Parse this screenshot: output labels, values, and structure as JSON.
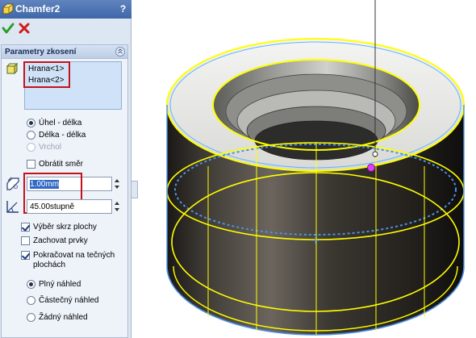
{
  "window": {
    "title": "Chamfer2",
    "help": "?"
  },
  "group": {
    "title": "Parametry zkosení"
  },
  "edges": {
    "items": [
      "Hrana<1>",
      "Hrana<2>"
    ]
  },
  "chamfer_type": {
    "options": [
      "Úhel - délka",
      "Délka - délka",
      "Vrchol"
    ],
    "selected": "Úhel - délka",
    "disabled": [
      "Vrchol"
    ]
  },
  "flip": {
    "label": "Obrátit směr",
    "checked": false
  },
  "distance": {
    "value": "1.00mm"
  },
  "angle": {
    "value": "45.00stupně"
  },
  "options": {
    "select_through_faces": {
      "label": "Výběr skrz plochy",
      "checked": true
    },
    "keep_features": {
      "label": "Zachovat prvky",
      "checked": false
    },
    "tangent_propagation": {
      "label": "Pokračovat na tečných plochách",
      "line1": "Pokračovat na tečných",
      "line2": "plochách",
      "checked": true
    }
  },
  "preview": {
    "options": [
      "Plný náhled",
      "Částečný náhled",
      "Žádný náhled"
    ],
    "selected": "Plný náhled"
  },
  "colors": {
    "title_bar": "#3f66a8",
    "highlight_box": "#c4121b",
    "edge_selection": "#ffff00",
    "panel_bg": "#dde6f3",
    "part_dark": "#2a2622"
  }
}
